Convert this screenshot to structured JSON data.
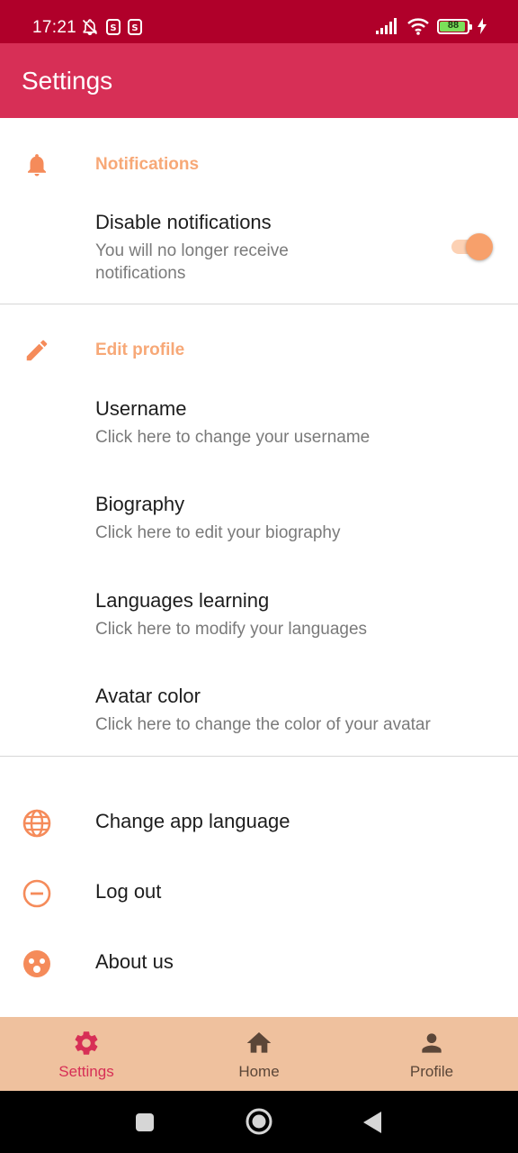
{
  "status_bar": {
    "time": "17:21",
    "battery_level": "88",
    "left_icons": [
      "notifications-off-icon",
      "s-app-icon",
      "s-app-icon"
    ],
    "right_icons": [
      "signal-icon",
      "wifi-icon",
      "battery-icon",
      "charging-icon"
    ]
  },
  "app_bar": {
    "title": "Settings",
    "color": "#d72f56"
  },
  "notifications_section": {
    "title": "Notifications",
    "icon": "bell-icon",
    "disable_notifications": {
      "title": "Disable notifications",
      "summary": "You will no longer receive notifications",
      "enabled": true
    }
  },
  "edit_profile_section": {
    "title": "Edit profile",
    "icon": "pencil-icon",
    "items": [
      {
        "title": "Username",
        "summary": "Click here to change your username"
      },
      {
        "title": "Biography",
        "summary": "Click here to edit your biography"
      },
      {
        "title": "Languages learning",
        "summary": "Click here to modify your languages"
      },
      {
        "title": "Avatar color",
        "summary": "Click here to change the color of your avatar"
      }
    ]
  },
  "actions": [
    {
      "label": "Change app language",
      "icon": "globe-icon"
    },
    {
      "label": "Log out",
      "icon": "minus-circle-icon"
    },
    {
      "label": "About us",
      "icon": "face-icon"
    }
  ],
  "bottom_nav": {
    "items": [
      {
        "label": "Settings",
        "icon": "gear-icon",
        "active": true
      },
      {
        "label": "Home",
        "icon": "home-icon",
        "active": false
      },
      {
        "label": "Profile",
        "icon": "person-icon",
        "active": false
      }
    ]
  },
  "colors": {
    "status_bar": "#b0002a",
    "accent": "#f7a877",
    "nav_background": "#efc19e",
    "nav_active": "#d72f56",
    "nav_inactive": "#5b4638"
  }
}
